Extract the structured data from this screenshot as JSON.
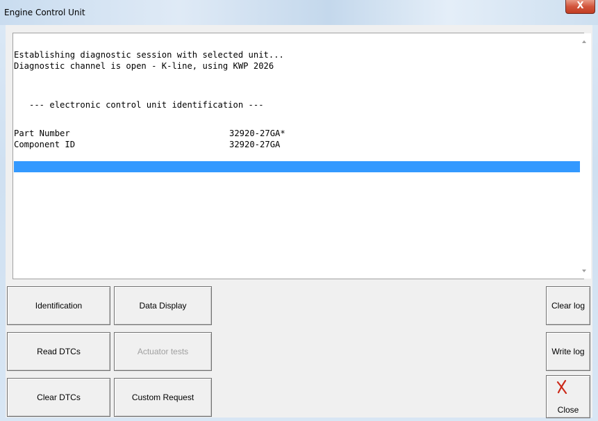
{
  "window": {
    "title": "Engine Control Unit",
    "close_glyph": "X"
  },
  "log": {
    "lines": [
      "Establishing diagnostic session with selected unit...",
      "Diagnostic channel is open - K-line, using KWP 2026",
      "   --- electronic control unit identification ---"
    ],
    "rows": [
      {
        "label": "Part Number",
        "value": "32920-27GA*"
      },
      {
        "label": "Component ID",
        "value": "32920-27GA"
      }
    ],
    "selected_row_color": "#3399ff"
  },
  "buttons": {
    "identification": "Identification",
    "data_display": "Data Display",
    "read_dtcs": "Read DTCs",
    "actuator_tests": "Actuator tests",
    "clear_dtcs": "Clear DTCs",
    "custom_request": "Custom Request",
    "clear_log": "Clear log",
    "write_log": "Write log",
    "close": "Close"
  },
  "icons": {
    "close_button_icon": "red-x-icon",
    "close_icon_color": "#cc2a1a"
  }
}
